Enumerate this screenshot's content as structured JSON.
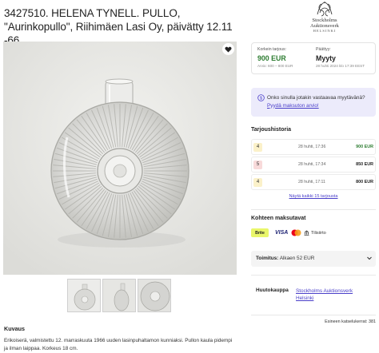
{
  "title": "3427510. HELENA TYNELL. PULLO, \"Aurinkopullo\", Riihimäen Lasi Oy, päivätty 12.11 -66.",
  "logo": {
    "line1": "Stockholms",
    "line2": "Auktionsverk",
    "line3": "HELSINKI"
  },
  "bid": {
    "current_label": "Korkein tarjous:",
    "current_value": "900 EUR",
    "estimate": "Arvio: 600 – 800 EUR",
    "ends_label": "Päättyy:",
    "ends_value": "Myyty",
    "ends_date": "28 huhti 2024 klo 17:39 EEST"
  },
  "ask": {
    "text": "Onko sinulla jotakin vastaavaa myytävänä?",
    "link": "Pyydä maksuton arvio!"
  },
  "history": {
    "heading": "Tarjoushistoria",
    "rows": [
      {
        "badge": "4",
        "date": "28 huhti, 17:36",
        "amount": "900 EUR",
        "color": "#fbf1c9",
        "amount_color": "#2e7d32"
      },
      {
        "badge": "5",
        "date": "28 huhti, 17:34",
        "amount": "850 EUR",
        "color": "#f8dada",
        "amount_color": "#222222"
      },
      {
        "badge": "4",
        "date": "28 huhti, 17:11",
        "amount": "800 EUR",
        "color": "#fbf1c9",
        "amount_color": "#222222"
      }
    ],
    "show_all": "Näytä kaikki 15 tarjousta"
  },
  "payment": {
    "heading": "Kohteen maksutavat",
    "brite": "Brite",
    "visa": "VISA",
    "tilisiirto": "Tilisiirto"
  },
  "shipping": {
    "label": "Toimitus:",
    "value": "Alkaen 52 EUR"
  },
  "auction_house": {
    "label": "Huutokauppa",
    "name": "Stockholms Auktionsverk Helsinki"
  },
  "views": "Esineen katselukerrat: 381",
  "description": {
    "heading": "Kuvaus",
    "text": "Erikoiserä, valmistettu 12. marraskuuta 1966 uuden lasinpuhaltamon kunniaksi. Pullon kaula pidempi ja ilman laippaa. Korkeus 18 cm."
  },
  "colors": {
    "accent": "#4a3fc9",
    "price_green": "#2e7d32",
    "ask_bg": "#ecebfb",
    "brite_yellow": "#e9f66a"
  }
}
